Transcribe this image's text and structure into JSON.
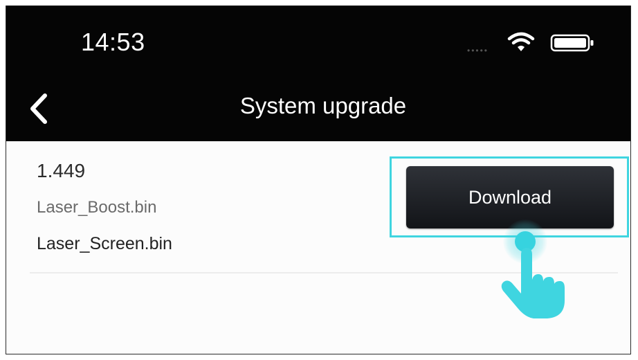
{
  "status_bar": {
    "time": "14:53",
    "signal_icon": "signal-dots-icon",
    "wifi_icon": "wifi-icon",
    "battery_icon": "battery-icon"
  },
  "nav": {
    "title": "System upgrade",
    "back_icon": "chevron-left-icon"
  },
  "firmware": {
    "version": "1.449",
    "files": [
      "Laser_Boost.bin",
      "Laser_Screen.bin"
    ]
  },
  "actions": {
    "download_label": "Download"
  },
  "colors": {
    "header_bg": "#050505",
    "highlight": "#3fd5e0",
    "button_bg": "#1e2126"
  }
}
